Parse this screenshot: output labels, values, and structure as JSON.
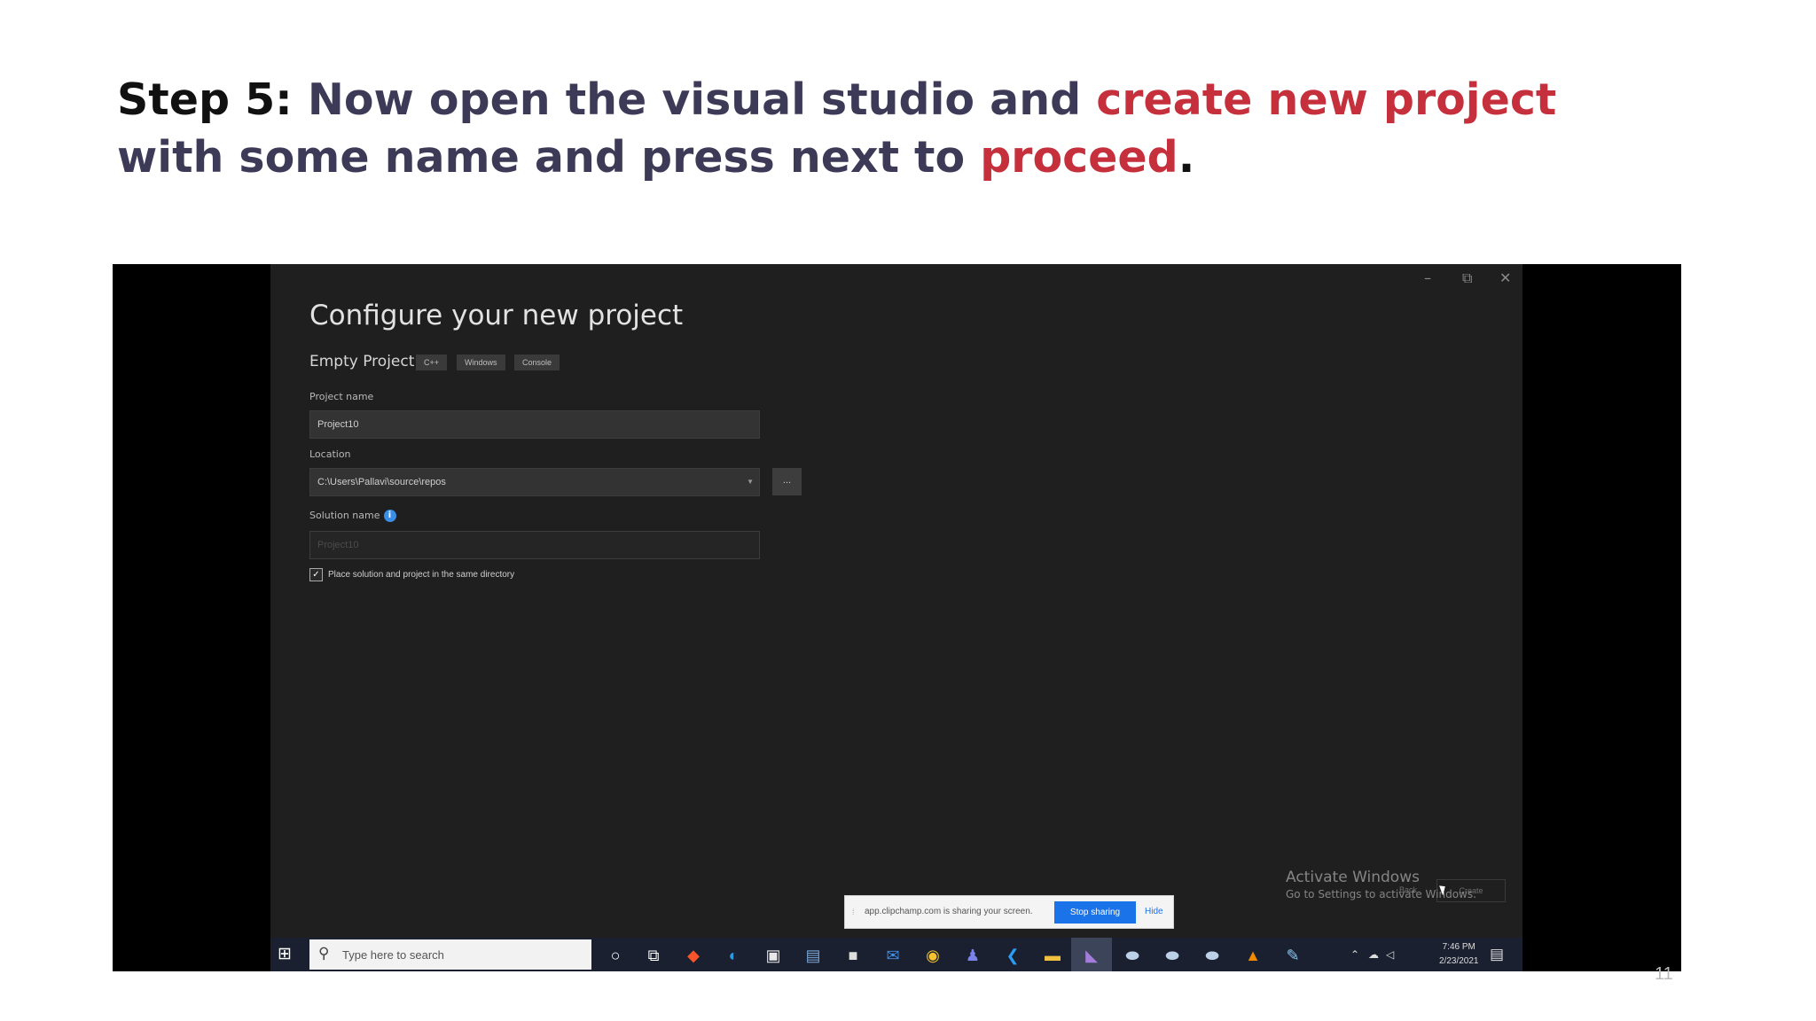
{
  "slide": {
    "title_lead": "Step 5:",
    "title_part1": " Now open the visual studio and ",
    "title_hl1": "create new project",
    "title_part2": " with some name and press next to ",
    "title_hl2": "proceed",
    "title_end": ".",
    "page_number": "11"
  },
  "window": {
    "minimize": "–",
    "restore": "⧉",
    "close": "✕"
  },
  "dialog": {
    "heading": "Configure your new project",
    "template_name": "Empty Project",
    "tags": [
      "C++",
      "Windows",
      "Console"
    ],
    "project_name_label": "Project name",
    "project_name_value": "Project10",
    "location_label": "Location",
    "location_value": "C:\\Users\\Pallavi\\source\\repos",
    "browse_label": "...",
    "solution_name_label": "Solution name",
    "solution_name_value": "Project10",
    "checkbox_label": "Place solution and project in the same directory",
    "back_label": "Back",
    "create_label": "Create"
  },
  "watermark": {
    "line1": "Activate Windows",
    "line2": "Go to Settings to activate Windows."
  },
  "share_bar": {
    "message": "app.clipchamp.com is sharing your screen.",
    "stop_label": "Stop sharing",
    "hide_label": "Hide"
  },
  "taskbar": {
    "search_placeholder": "Type here to search",
    "time": "7:46 PM",
    "date": "2/23/2021",
    "icons": [
      "windows-start-icon",
      "cortana-icon",
      "task-view-icon",
      "brave-icon",
      "edge-icon",
      "store-icon",
      "app-icon",
      "terminal-icon",
      "mail-icon",
      "chrome-icon",
      "teams-icon",
      "vscode-icon",
      "file-explorer-icon",
      "visual-studio-icon",
      "app-icon",
      "app-icon",
      "app-icon",
      "vlc-icon",
      "notepad-icon"
    ]
  }
}
